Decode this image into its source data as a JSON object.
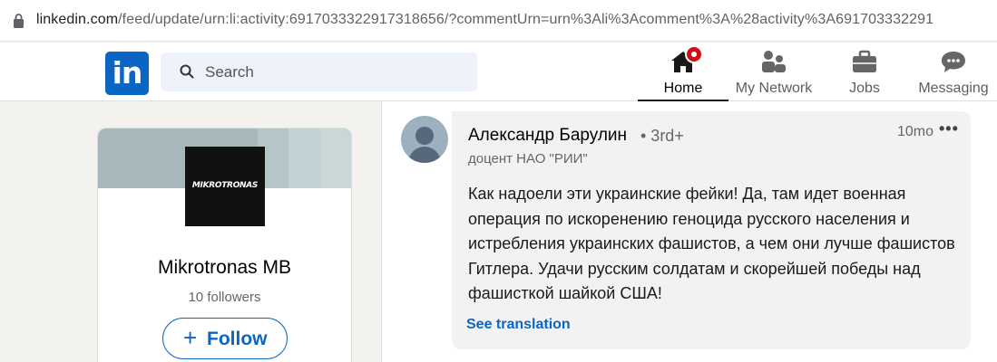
{
  "browser": {
    "url_domain": "linkedin.com",
    "url_path": "/feed/update/urn:li:activity:6917033322917318656/?commentUrn=urn%3Ali%3Acomment%3A%28activity%3A691703332291"
  },
  "header": {
    "logo_text": "in",
    "search_placeholder": "Search",
    "nav": [
      {
        "label": "Home",
        "active": true
      },
      {
        "label": "My Network"
      },
      {
        "label": "Jobs"
      },
      {
        "label": "Messaging"
      }
    ]
  },
  "company_card": {
    "logo_text": "MIKROTRONAS",
    "name": "Mikrotronas MB",
    "followers": "10 followers",
    "follow_label": "Follow",
    "follow_plus": "+"
  },
  "comment": {
    "author": "Александр Барулин",
    "degree": "• 3rd+",
    "headline": "доцент НАО \"РИИ\"",
    "time": "10mo",
    "more": "•••",
    "text": "Как надоели эти украинские фейки! Да, там идет военная операция по искоренению геноцида русского населения и истребления украинских фашистов, а чем они лучше фашистов Гитлера. Удачи русским солдатам и скорейшей победы над фашисткой шайкой США!",
    "see_translation": "See translation"
  },
  "colors": {
    "brand": "#0a66c2",
    "notification": "#cc1016"
  }
}
